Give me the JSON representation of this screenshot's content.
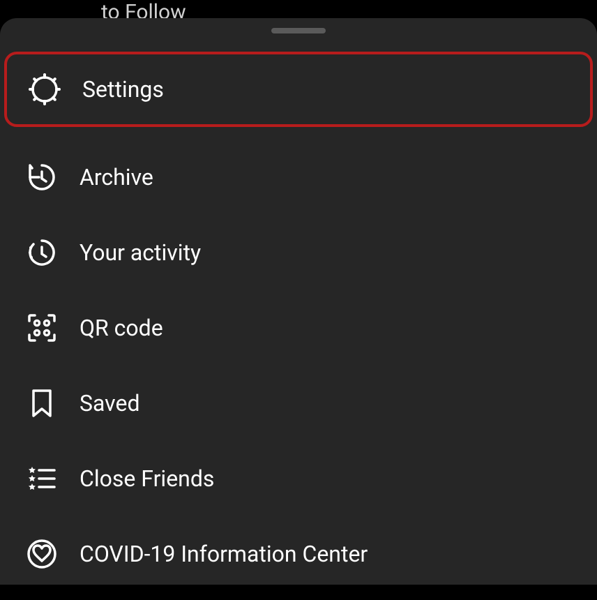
{
  "background": {
    "partial_text": "to Follow"
  },
  "menu": {
    "items": [
      {
        "label": "Settings",
        "highlighted": true
      },
      {
        "label": "Archive",
        "highlighted": false
      },
      {
        "label": "Your activity",
        "highlighted": false
      },
      {
        "label": "QR code",
        "highlighted": false
      },
      {
        "label": "Saved",
        "highlighted": false
      },
      {
        "label": "Close Friends",
        "highlighted": false
      },
      {
        "label": "COVID-19 Information Center",
        "highlighted": false
      }
    ]
  }
}
